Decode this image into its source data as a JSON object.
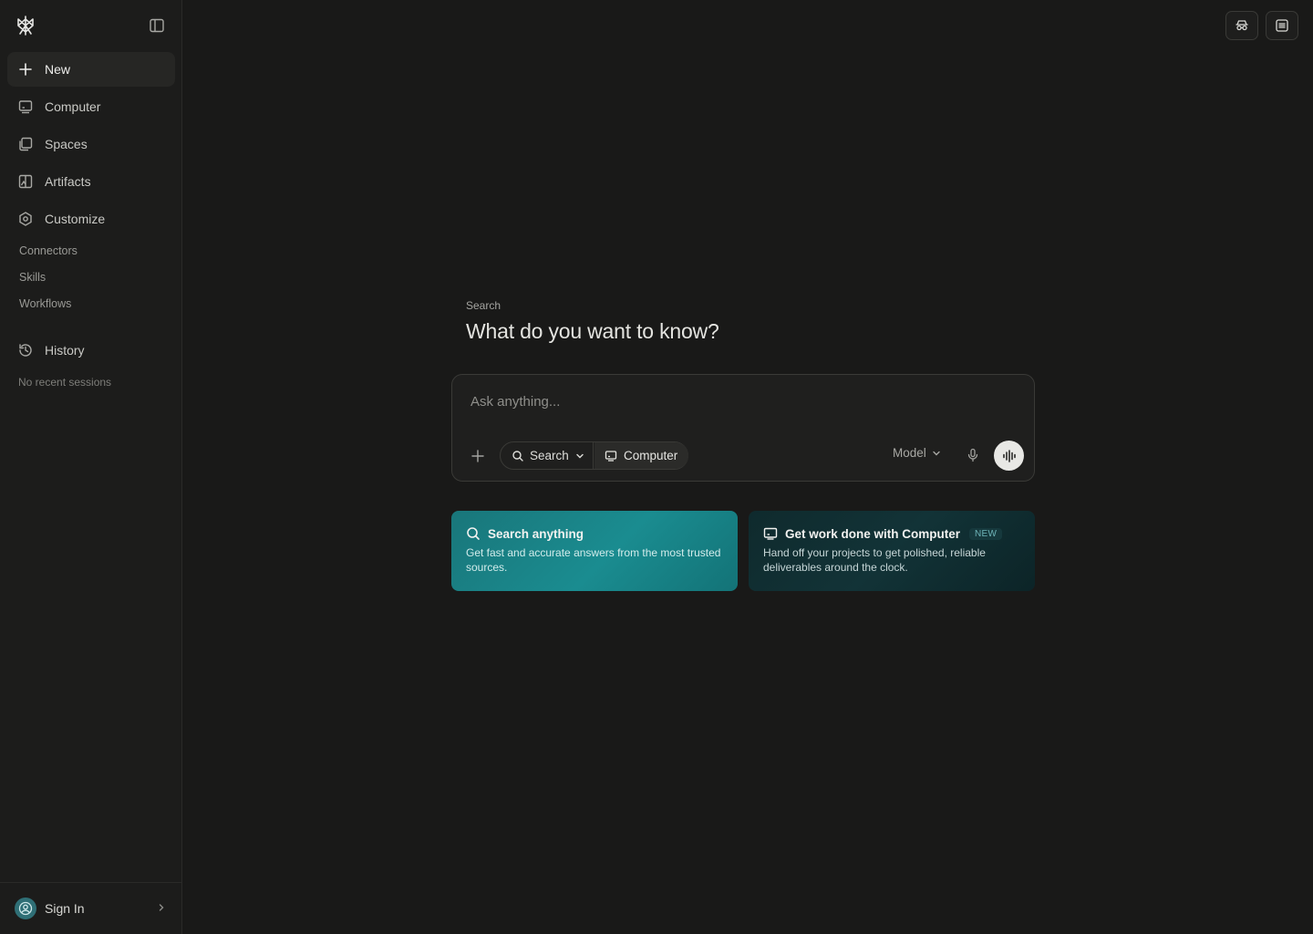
{
  "sidebar": {
    "new_label": "New",
    "items": [
      {
        "label": "Computer",
        "icon": "monitor-icon"
      },
      {
        "label": "Spaces",
        "icon": "stack-icon"
      },
      {
        "label": "Artifacts",
        "icon": "artifact-icon"
      },
      {
        "label": "Customize",
        "icon": "hexagon-gear-icon"
      }
    ],
    "sub_items": [
      "Connectors",
      "Skills",
      "Workflows"
    ],
    "history_label": "History",
    "no_recent": "No recent sessions",
    "signin_label": "Sign In"
  },
  "main": {
    "heading_label": "Search",
    "heading": "What do you want to know?",
    "composer": {
      "placeholder": "Ask anything...",
      "mode_search": "Search",
      "mode_computer": "Computer",
      "model_label": "Model"
    },
    "cards": {
      "search": {
        "title": "Search anything",
        "desc": "Get fast and accurate answers from the most trusted sources."
      },
      "computer": {
        "title": "Get work done with Computer",
        "badge": "NEW",
        "desc": "Hand off your projects to get polished, reliable deliverables around the clock."
      }
    }
  },
  "colors": {
    "background": "#191918",
    "sidebar": "#1c1c1b",
    "accent_teal": "#1a8c90"
  }
}
